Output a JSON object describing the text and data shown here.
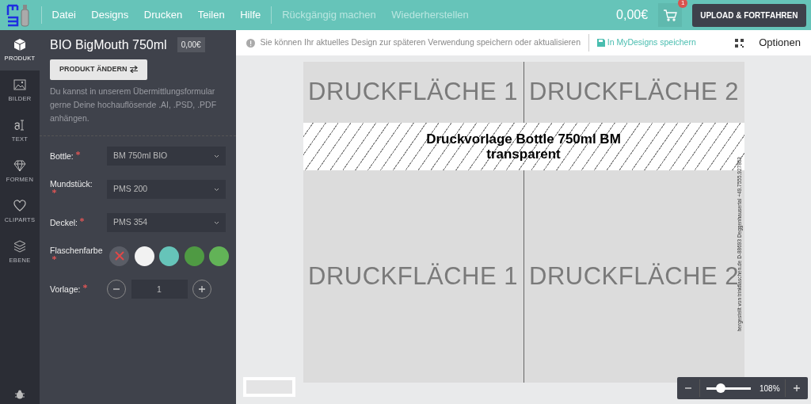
{
  "navbar": {
    "menu": [
      "Datei",
      "Designs",
      "Drucken",
      "Teilen",
      "Hilfe"
    ],
    "actions": [
      {
        "label": "Rückgängig machen",
        "disabled": true
      },
      {
        "label": "Wiederherstellen",
        "disabled": true
      }
    ],
    "price": "0,00€",
    "cart_badge": "1",
    "upload_button": "UPLOAD & FORTFAHREN"
  },
  "rail": {
    "items": [
      {
        "label": "PRODUKT",
        "selected": true
      },
      {
        "label": "BILDER",
        "selected": false
      },
      {
        "label": "TEXT",
        "selected": false
      },
      {
        "label": "FORMEN",
        "selected": false
      },
      {
        "label": "CLIPARTS",
        "selected": false
      },
      {
        "label": "EBENE",
        "selected": false
      }
    ]
  },
  "panel": {
    "title": "BIO BigMouth 750ml",
    "price": "0,00€",
    "change_button": "PRODUKT ÄNDERN",
    "description": "Du kannst in unserem Übermittlungsformular gerne Deine hochauflösende .AI, .PSD, .PDF anhängen.",
    "fields": [
      {
        "kind": "select",
        "label": "Bottle:",
        "required": true,
        "value": "BM 750ml BIO"
      },
      {
        "kind": "select",
        "label": "Mundstück:",
        "required": true,
        "value": "PMS 200"
      },
      {
        "kind": "select",
        "label": "Deckel:",
        "required": true,
        "value": "PMS 354"
      },
      {
        "kind": "swatches",
        "label": "Flaschenfarbe",
        "required": true,
        "swatches": [
          {
            "kind": "none",
            "color": "#5a5d66",
            "selected": false
          },
          {
            "kind": "color",
            "color": "#f2f2f2",
            "selected": false
          },
          {
            "kind": "color",
            "color": "#66c4b9",
            "selected": false
          },
          {
            "kind": "color",
            "color": "#4f9a43",
            "selected": false
          },
          {
            "kind": "color",
            "color": "#62b357",
            "selected": false
          }
        ]
      },
      {
        "kind": "stepper",
        "label": "Vorlage:",
        "required": true,
        "value": "1"
      }
    ]
  },
  "info_bar": {
    "message": "Sie können Ihr aktuelles Design zur späteren Verwendung speichern oder aktualisieren",
    "save_link": "In MyDesigns speichern",
    "options": "Optionen"
  },
  "canvas": {
    "top_areas": [
      "DRUCKFLÄCHE 1",
      "DRUCKFLÄCHE 2"
    ],
    "banner": [
      "Druckvorlage Bottle 750ml BM",
      "transparent"
    ],
    "bottom_areas": [
      "DRUCKFLÄCHE 1",
      "DRUCKFLÄCHE 2"
    ],
    "side_note": "hergestellt von trinkflaschen.de D-88693 Deggenhausertal +49.7555.927863"
  },
  "zoom": {
    "level": 0.33,
    "reading": "108%"
  }
}
